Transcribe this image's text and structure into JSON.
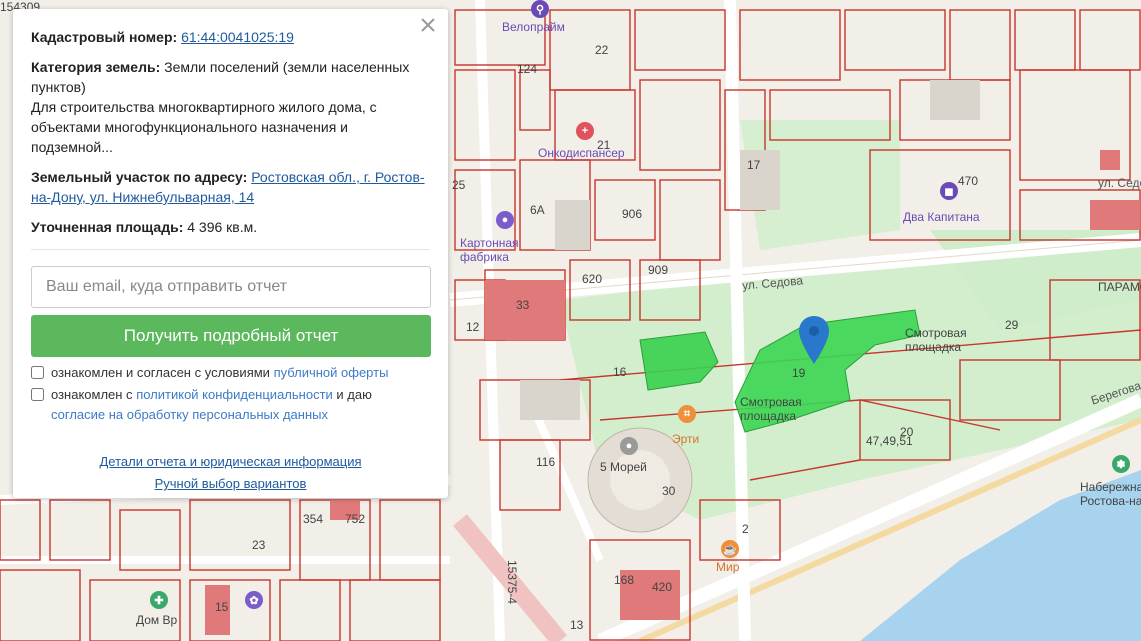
{
  "panel": {
    "cadastral_label": "Кадастровый номер:",
    "cadastral_value": "61:44:0041025:19",
    "category_label": "Категория земель:",
    "category_value": "Земли поселений (земли населенных пунктов)",
    "purpose_text": "Для строительства многоквартирного жилого дома, с объектами многофункционального назначения и подземной...",
    "address_label": "Земельный участок по адресу:",
    "address_value": "Ростовская обл., г. Ростов-на-Дону, ул. Нижнебульварная, 14",
    "area_label": "Уточненная площадь:",
    "area_value": "4 396 кв.м.",
    "email_placeholder": "Ваш email, куда отправить отчет",
    "submit_label": "Получить подробный отчет",
    "offer_text": "ознакомлен и согласен с условиями",
    "offer_link": "публичной оферты",
    "privacy_text": "ознакомлен с",
    "privacy_link": "политикой конфиденциальности",
    "privacy_tail": "и даю",
    "consent_link": "согласие на обработку персональных данных",
    "details_link": "Детали отчета и юридическая информация",
    "manual_link": "Ручной выбор вариантов",
    "close_icon": "close-icon"
  },
  "map": {
    "labels": [
      {
        "id": "velopraim",
        "text": "Велопрайм",
        "cls": "poi"
      },
      {
        "id": "onkodispanser",
        "text": "Онкодиспансер",
        "cls": "poi"
      },
      {
        "id": "kartonnaya",
        "text": "Картонная фабрика",
        "cls": "poi"
      },
      {
        "id": "dva-kapitana",
        "text": "Два Капитана",
        "cls": "poi"
      },
      {
        "id": "ul-sedova",
        "text": "ул. Седова",
        "cls": "street"
      },
      {
        "id": "ul-sedova-2",
        "text": "ул. Седова",
        "cls": "street"
      },
      {
        "id": "smotrovaya-1",
        "text": "Смотровая площадка",
        "cls": "dark"
      },
      {
        "id": "smotrovaya-2",
        "text": "Смотровая площадка",
        "cls": "dark"
      },
      {
        "id": "erti",
        "text": "Эрти",
        "cls": "poi-orange"
      },
      {
        "id": "5-morey",
        "text": "5 Морей",
        "cls": "dark"
      },
      {
        "id": "mir",
        "text": "Мир",
        "cls": "poi-orange"
      },
      {
        "id": "beregovaya",
        "text": "Береговая",
        "cls": "street"
      },
      {
        "id": "naberezhnaya",
        "text": "Набережная Ростова-на",
        "cls": "dark"
      },
      {
        "id": "paramon",
        "text": "ПАРАМО СКЛ",
        "cls": "dark"
      },
      {
        "id": "dom-vrachey",
        "text": "Дом Вр",
        "cls": "dark"
      },
      {
        "id": "n154309",
        "text": "154309",
        "cls": "dark"
      },
      {
        "id": "n47",
        "text": "47,49,51",
        "cls": "dark"
      },
      {
        "id": "n470",
        "text": "470",
        "cls": "dark"
      },
      {
        "id": "n19",
        "text": "19",
        "cls": "dark"
      },
      {
        "id": "n20",
        "text": "20",
        "cls": "dark"
      },
      {
        "id": "n29",
        "text": "29",
        "cls": "dark"
      },
      {
        "id": "n33",
        "text": "33",
        "cls": "dark"
      },
      {
        "id": "n620",
        "text": "620",
        "cls": "dark"
      },
      {
        "id": "n909",
        "text": "909",
        "cls": "dark"
      },
      {
        "id": "n906",
        "text": "906",
        "cls": "dark"
      },
      {
        "id": "n17",
        "text": "17",
        "cls": "dark"
      },
      {
        "id": "n21",
        "text": "21",
        "cls": "dark"
      },
      {
        "id": "n124",
        "text": "124",
        "cls": "dark"
      },
      {
        "id": "n22",
        "text": "22",
        "cls": "dark"
      },
      {
        "id": "n6a",
        "text": "6А",
        "cls": "dark"
      },
      {
        "id": "n25",
        "text": "25",
        "cls": "dark"
      },
      {
        "id": "n12",
        "text": "12",
        "cls": "dark"
      },
      {
        "id": "n16",
        "text": "16",
        "cls": "dark"
      },
      {
        "id": "n116",
        "text": "116",
        "cls": "dark"
      },
      {
        "id": "n30",
        "text": "30",
        "cls": "dark"
      },
      {
        "id": "n168",
        "text": "168",
        "cls": "dark"
      },
      {
        "id": "n420",
        "text": "420",
        "cls": "dark"
      },
      {
        "id": "n13",
        "text": "13",
        "cls": "dark"
      },
      {
        "id": "n2",
        "text": "2",
        "cls": "dark"
      },
      {
        "id": "n23",
        "text": "23",
        "cls": "dark"
      },
      {
        "id": "n354",
        "text": "354",
        "cls": "dark"
      },
      {
        "id": "n752",
        "text": "752",
        "cls": "dark"
      },
      {
        "id": "n15",
        "text": "15",
        "cls": "dark"
      },
      {
        "id": "n1537",
        "text": "15375-4",
        "cls": "dark"
      }
    ]
  }
}
